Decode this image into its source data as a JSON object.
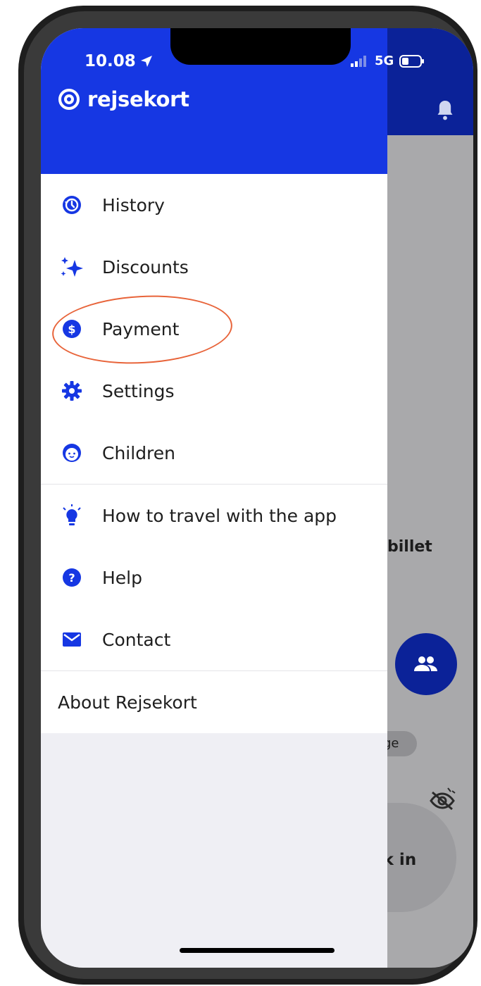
{
  "status_bar": {
    "time": "10.08",
    "network": "5G"
  },
  "brand": {
    "name": "rejsekort"
  },
  "menu": {
    "items": [
      {
        "label": "History",
        "icon": "history-icon"
      },
      {
        "label": "Discounts",
        "icon": "sparkles-icon"
      },
      {
        "label": "Payment",
        "icon": "dollar-icon"
      },
      {
        "label": "Settings",
        "icon": "gear-icon"
      },
      {
        "label": "Children",
        "icon": "child-face-icon"
      }
    ],
    "secondary": [
      {
        "label": "How to travel with the app",
        "icon": "lightbulb-icon"
      },
      {
        "label": "Help",
        "icon": "question-icon"
      },
      {
        "label": "Contact",
        "icon": "mail-icon"
      }
    ],
    "about": "About Rejsekort"
  },
  "background": {
    "ticket_text": "billet",
    "chip_text": "ge",
    "checkin_text": "ck in"
  },
  "colors": {
    "brand_blue": "#1637e3",
    "header_dark": "#0b2298",
    "annotation": "#e8643a"
  }
}
